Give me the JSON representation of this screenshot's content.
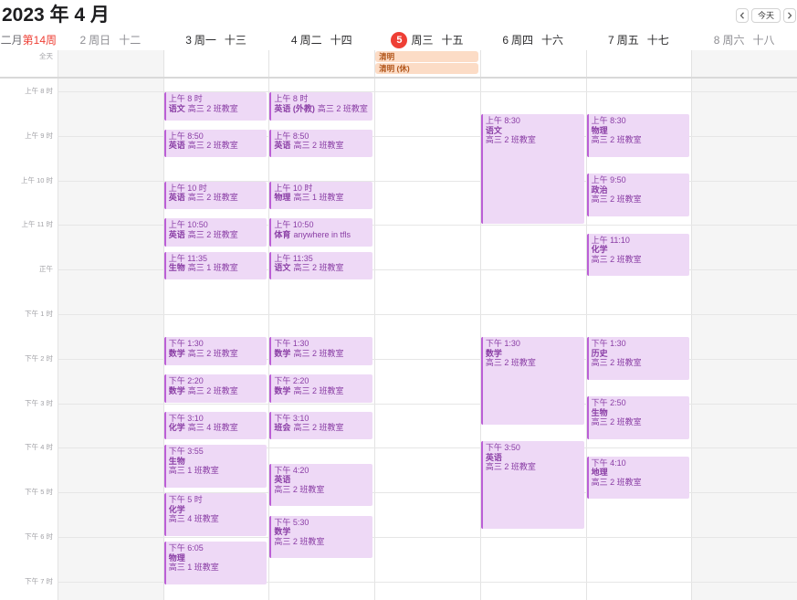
{
  "window": {
    "title": "2023 年 4 月"
  },
  "nav": {
    "prev_icon": "chevron-left-icon",
    "today_label": "今天",
    "next_icon": "chevron-right-icon"
  },
  "week_label": {
    "month": "二月",
    "week": "第14周"
  },
  "all_day_label": "全天",
  "time_labels": [
    "上午 8 时",
    "上午 9 时",
    "上午 10 时",
    "上午 11 时",
    "正午",
    "下午 1 时",
    "下午 2 时",
    "下午 3 时",
    "下午 4 时",
    "下午 5 时",
    "下午 6 时",
    "下午 7 时"
  ],
  "colors": {
    "accent_red": "#ee3f35",
    "weekend_background": "#f5f5f5",
    "event_background": "#eed9f6",
    "event_bar": "#bb5fd6",
    "event_text": "#8a3ea5",
    "holiday_background": "#fcdcc6",
    "holiday_text": "#b2561b"
  },
  "days": [
    {
      "day": "2",
      "weekday": "周日",
      "lunar": "十二",
      "weekend": true,
      "today": false,
      "all_day": [],
      "events": []
    },
    {
      "day": "3",
      "weekday": "周一",
      "lunar": "十三",
      "weekend": false,
      "today": false,
      "all_day": [],
      "events": [
        {
          "time": "上午 8 时",
          "title": "语文",
          "location": "高三 2 班教室",
          "start": "08:00",
          "end": "08:40"
        },
        {
          "time": "上午 8:50",
          "title": "英语",
          "location": "高三 2 班教室",
          "start": "08:50",
          "end": "09:30"
        },
        {
          "time": "上午 10 时",
          "title": "英语",
          "location": "高三 2 班教室",
          "start": "10:00",
          "end": "10:40"
        },
        {
          "time": "上午 10:50",
          "title": "英语",
          "location": "高三 2 班教室",
          "start": "10:50",
          "end": "11:30"
        },
        {
          "time": "上午 11:35",
          "title": "生物",
          "location": "高三 1 班教室",
          "start": "11:35",
          "end": "12:15"
        },
        {
          "time": "下午 1:30",
          "title": "数学",
          "location": "高三 2 班教室",
          "start": "13:30",
          "end": "14:10"
        },
        {
          "time": "下午 2:20",
          "title": "数学",
          "location": "高三 2 班教室",
          "start": "14:20",
          "end": "15:00"
        },
        {
          "time": "下午 3:10",
          "title": "化学",
          "location": "高三 4 班教室",
          "start": "15:10",
          "end": "15:50"
        },
        {
          "time": "下午 3:55",
          "title": "生物",
          "location": "高三 1 班教室",
          "start": "15:55",
          "end": "16:55"
        },
        {
          "time": "下午 5 时",
          "title": "化学",
          "location": "高三 4 班教室",
          "start": "17:00",
          "end": "18:00"
        },
        {
          "time": "下午 6:05",
          "title": "物理",
          "location": "高三 1 班教室",
          "start": "18:05",
          "end": "19:05"
        }
      ]
    },
    {
      "day": "4",
      "weekday": "周二",
      "lunar": "十四",
      "weekend": false,
      "today": false,
      "all_day": [],
      "events": [
        {
          "time": "上午 8 时",
          "title": "英语 (外教)",
          "location": "高三 2 班教室",
          "start": "08:00",
          "end": "08:40"
        },
        {
          "time": "上午 8:50",
          "title": "英语",
          "location": "高三 2 班教室",
          "start": "08:50",
          "end": "09:30"
        },
        {
          "time": "上午 10 时",
          "title": "物理",
          "location": "高三 1 班教室",
          "start": "10:00",
          "end": "10:40"
        },
        {
          "time": "上午 10:50",
          "title": "体育",
          "location": "anywhere in tfls",
          "start": "10:50",
          "end": "11:30"
        },
        {
          "time": "上午 11:35",
          "title": "语文",
          "location": "高三 2 班教室",
          "start": "11:35",
          "end": "12:15"
        },
        {
          "time": "下午 1:30",
          "title": "数学",
          "location": "高三 2 班教室",
          "start": "13:30",
          "end": "14:10"
        },
        {
          "time": "下午 2:20",
          "title": "数学",
          "location": "高三 2 班教室",
          "start": "14:20",
          "end": "15:00"
        },
        {
          "time": "下午 3:10",
          "title": "班会",
          "location": "高三 2 班教室",
          "start": "15:10",
          "end": "15:50"
        },
        {
          "time": "下午 4:20",
          "title": "英语",
          "location": "高三 2 班教室",
          "start": "16:20",
          "end": "17:20"
        },
        {
          "time": "下午 5:30",
          "title": "数学",
          "location": "高三 2 班教室",
          "start": "17:30",
          "end": "18:30"
        }
      ]
    },
    {
      "day": "5",
      "weekday": "周三",
      "lunar": "十五",
      "weekend": false,
      "today": true,
      "all_day": [
        "清明",
        "清明 (休)"
      ],
      "events": []
    },
    {
      "day": "6",
      "weekday": "周四",
      "lunar": "十六",
      "weekend": false,
      "today": false,
      "all_day": [],
      "events": [
        {
          "time": "上午 8:30",
          "title": "语文",
          "location": "高三 2 班教室",
          "start": "08:30",
          "end": "11:00"
        },
        {
          "time": "下午 1:30",
          "title": "数学",
          "location": "高三 2 班教室",
          "start": "13:30",
          "end": "15:30"
        },
        {
          "time": "下午 3:50",
          "title": "英语",
          "location": "高三 2 班教室",
          "start": "15:50",
          "end": "17:50"
        }
      ]
    },
    {
      "day": "7",
      "weekday": "周五",
      "lunar": "十七",
      "weekend": false,
      "today": false,
      "all_day": [],
      "events": [
        {
          "time": "上午 8:30",
          "title": "物理",
          "location": "高三 2 班教室",
          "start": "08:30",
          "end": "09:30"
        },
        {
          "time": "上午 9:50",
          "title": "政治",
          "location": "高三 2 班教室",
          "start": "09:50",
          "end": "10:50"
        },
        {
          "time": "上午 11:10",
          "title": "化学",
          "location": "高三 2 班教室",
          "start": "11:10",
          "end": "12:10"
        },
        {
          "time": "下午 1:30",
          "title": "历史",
          "location": "高三 2 班教室",
          "start": "13:30",
          "end": "14:30"
        },
        {
          "time": "下午 2:50",
          "title": "生物",
          "location": "高三 2 班教室",
          "start": "14:50",
          "end": "15:50"
        },
        {
          "time": "下午 4:10",
          "title": "地理",
          "location": "高三 2 班教室",
          "start": "16:10",
          "end": "17:10"
        }
      ]
    },
    {
      "day": "8",
      "weekday": "周六",
      "lunar": "十八",
      "weekend": true,
      "today": false,
      "all_day": [],
      "events": []
    }
  ]
}
